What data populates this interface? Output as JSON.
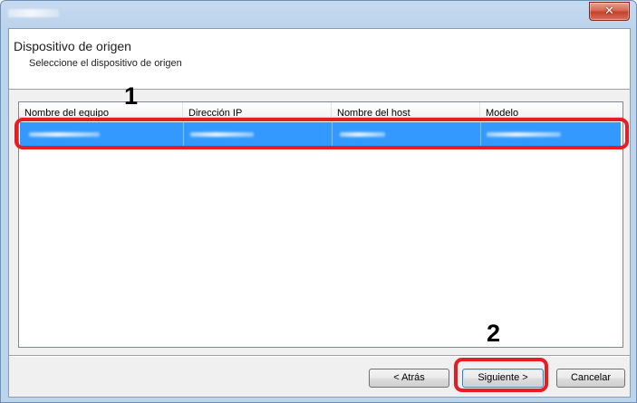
{
  "window": {
    "close_glyph": "✕"
  },
  "header": {
    "title": "Dispositivo de origen",
    "subtitle": "Seleccione el dispositivo de origen"
  },
  "table": {
    "columns": [
      "Nombre del equipo",
      "Dirección IP",
      "Nombre del host",
      "Modelo"
    ],
    "selected_row_color": "#3399ff"
  },
  "annotations": {
    "step1": "1",
    "step2": "2",
    "highlight_color": "#e31e24"
  },
  "buttons": {
    "back": "< Atrás",
    "next": "Siguiente >",
    "cancel": "Cancelar"
  },
  "icons": {
    "close": "close-icon"
  }
}
